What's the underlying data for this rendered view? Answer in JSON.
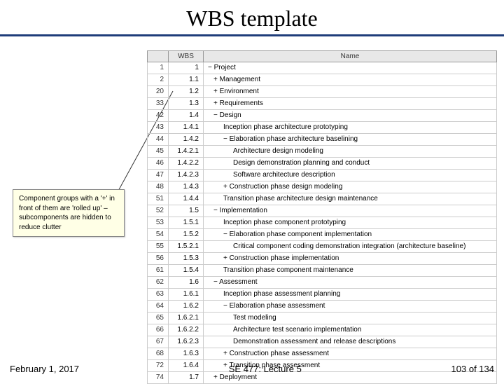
{
  "title": "WBS template",
  "headers": {
    "col1": "WBS",
    "col2": "Name"
  },
  "rows": [
    {
      "n": "1",
      "wbs": "1",
      "name": "− Project",
      "indent": 0
    },
    {
      "n": "2",
      "wbs": "1.1",
      "name": "+ Management",
      "indent": 1
    },
    {
      "n": "20",
      "wbs": "1.2",
      "name": "+ Environment",
      "indent": 1
    },
    {
      "n": "33",
      "wbs": "1.3",
      "name": "+ Requirements",
      "indent": 1
    },
    {
      "n": "42",
      "wbs": "1.4",
      "name": "− Design",
      "indent": 1
    },
    {
      "n": "43",
      "wbs": "1.4.1",
      "name": "Inception phase architecture prototyping",
      "indent": 2
    },
    {
      "n": "44",
      "wbs": "1.4.2",
      "name": "− Elaboration phase architecture baselining",
      "indent": 2
    },
    {
      "n": "45",
      "wbs": "1.4.2.1",
      "name": "Architecture design modeling",
      "indent": 3
    },
    {
      "n": "46",
      "wbs": "1.4.2.2",
      "name": "Design demonstration planning and conduct",
      "indent": 3
    },
    {
      "n": "47",
      "wbs": "1.4.2.3",
      "name": "Software architecture description",
      "indent": 3
    },
    {
      "n": "48",
      "wbs": "1.4.3",
      "name": "+ Construction phase design modeling",
      "indent": 2
    },
    {
      "n": "51",
      "wbs": "1.4.4",
      "name": "Transition phase architecture design maintenance",
      "indent": 2
    },
    {
      "n": "52",
      "wbs": "1.5",
      "name": "− Implementation",
      "indent": 1
    },
    {
      "n": "53",
      "wbs": "1.5.1",
      "name": "Inception phase component prototyping",
      "indent": 2
    },
    {
      "n": "54",
      "wbs": "1.5.2",
      "name": "− Elaboration phase component implementation",
      "indent": 2
    },
    {
      "n": "55",
      "wbs": "1.5.2.1",
      "name": "Critical component coding demonstration integration (architecture baseline)",
      "indent": 3
    },
    {
      "n": "56",
      "wbs": "1.5.3",
      "name": "+ Construction phase implementation",
      "indent": 2
    },
    {
      "n": "61",
      "wbs": "1.5.4",
      "name": "Transition phase component maintenance",
      "indent": 2
    },
    {
      "n": "62",
      "wbs": "1.6",
      "name": "− Assessment",
      "indent": 1
    },
    {
      "n": "63",
      "wbs": "1.6.1",
      "name": "Inception phase assessment planning",
      "indent": 2
    },
    {
      "n": "64",
      "wbs": "1.6.2",
      "name": "− Elaboration phase assessment",
      "indent": 2
    },
    {
      "n": "65",
      "wbs": "1.6.2.1",
      "name": "Test modeling",
      "indent": 3
    },
    {
      "n": "66",
      "wbs": "1.6.2.2",
      "name": "Architecture test scenario implementation",
      "indent": 3
    },
    {
      "n": "67",
      "wbs": "1.6.2.3",
      "name": "Demonstration assessment and release descriptions",
      "indent": 3
    },
    {
      "n": "68",
      "wbs": "1.6.3",
      "name": "+ Construction phase assessment",
      "indent": 2
    },
    {
      "n": "72",
      "wbs": "1.6.4",
      "name": "+ Transition phase assessment",
      "indent": 2
    },
    {
      "n": "74",
      "wbs": "1.7",
      "name": "+ Deployment",
      "indent": 1
    }
  ],
  "callout": "Component groups with a '+' in front of them are 'rolled up' – subcomponents are hidden to reduce clutter",
  "footer": {
    "left": "February 1, 2017",
    "center": "SE 477: Lecture 5",
    "right": "103 of 134"
  }
}
